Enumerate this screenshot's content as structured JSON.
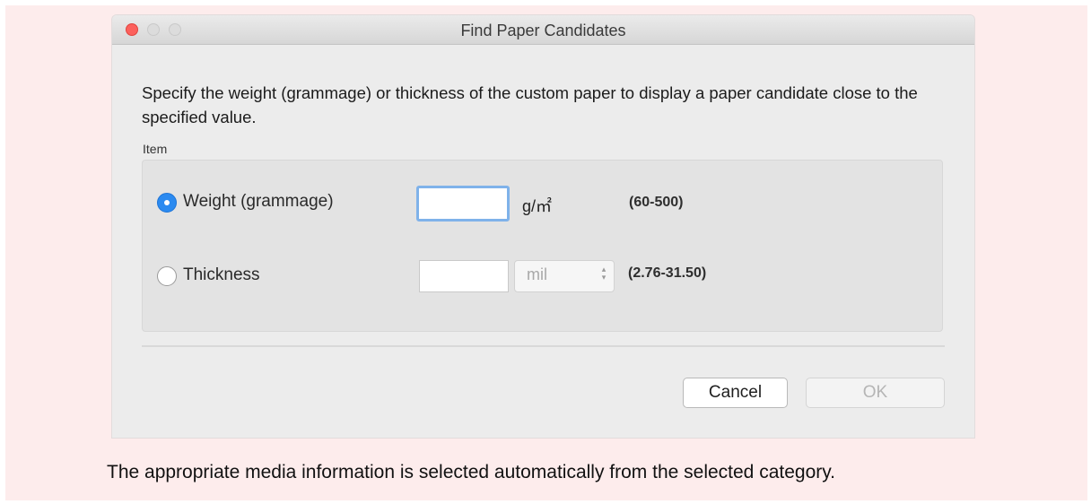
{
  "window": {
    "title": "Find Paper Candidates"
  },
  "dialog": {
    "description": "Specify the weight (grammage) or thickness of the custom paper to display a paper candidate close to the specified value.",
    "group_label": "Item",
    "weight": {
      "label": "Weight (grammage)",
      "value": "",
      "unit": "g/㎡",
      "range": "(60-500)",
      "selected": true
    },
    "thickness": {
      "label": "Thickness",
      "value": "",
      "unit_select": "mil",
      "range": "(2.76-31.50)",
      "selected": false
    },
    "cancel_label": "Cancel",
    "ok_label": "OK"
  },
  "caption": "The appropriate media information is selected automatically from the selected category.",
  "icons": {
    "close": "close-button-icon",
    "minimize": "minimize-button-icon",
    "zoom": "zoom-button-icon",
    "stepper": "up-down-stepper-icon"
  },
  "colors": {
    "background": "#fdecec",
    "dialog": "#ececec",
    "accent": "#2b8af0",
    "close": "#fc615d",
    "focus_ring": "#7fb2ea"
  }
}
